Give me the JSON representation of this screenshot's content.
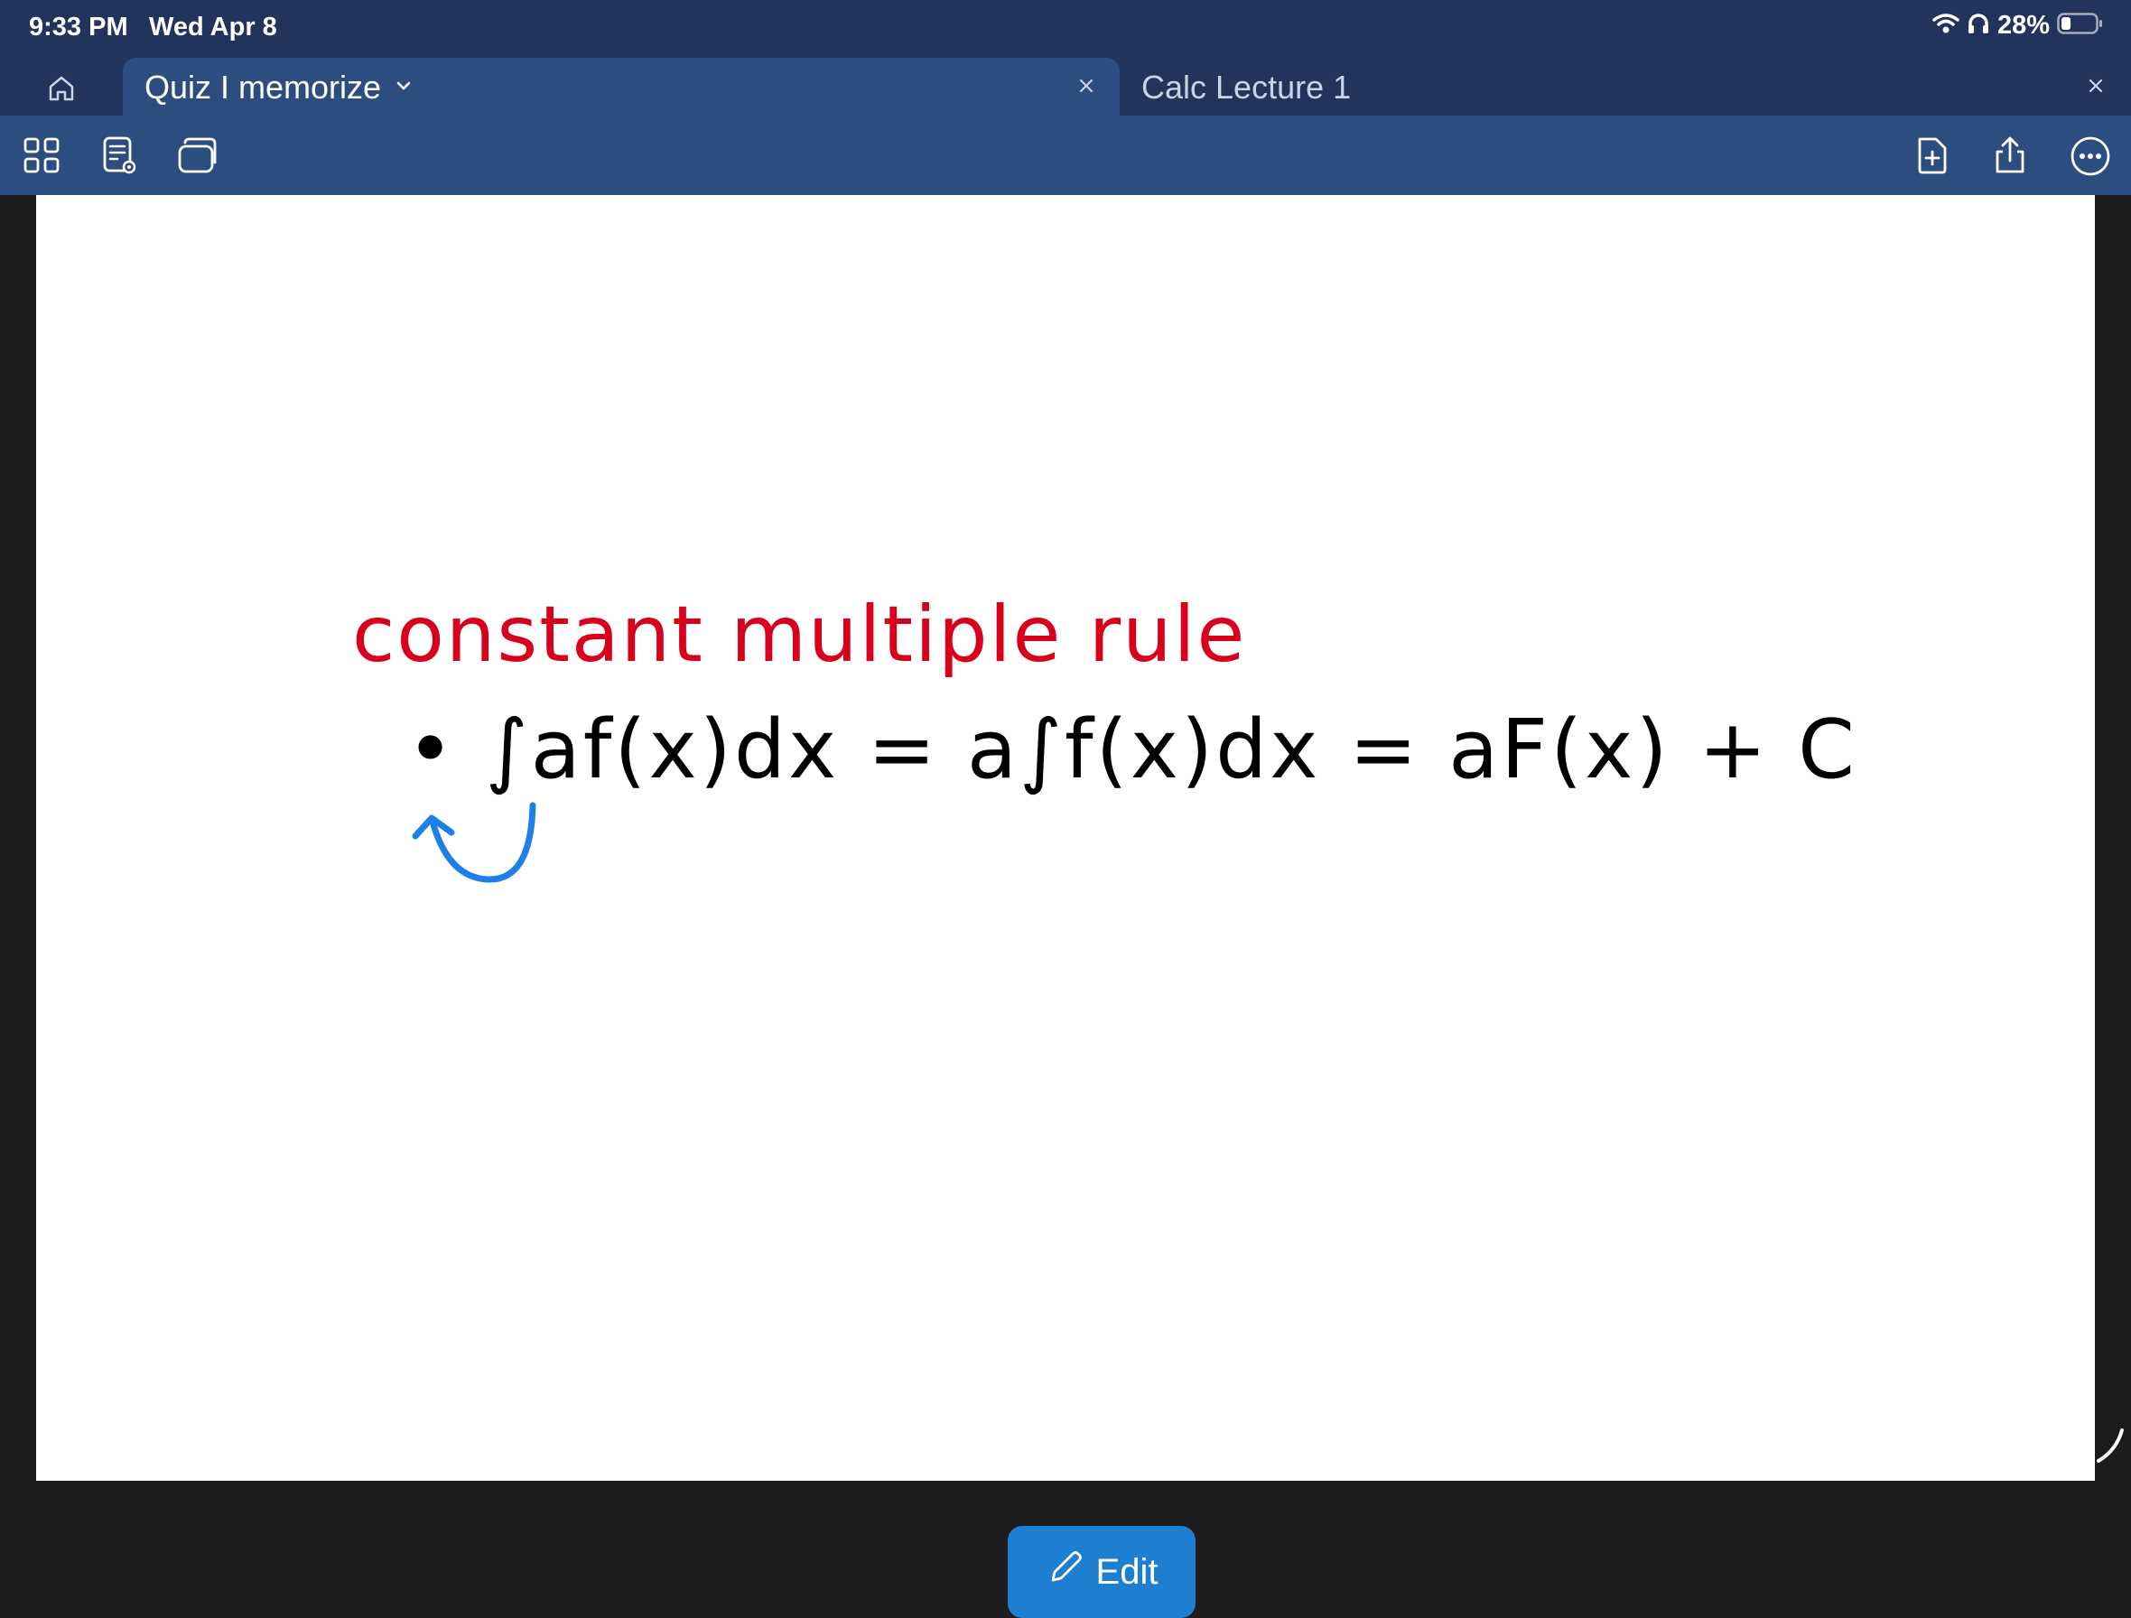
{
  "status_bar": {
    "time": "9:33 PM",
    "date": "Wed Apr 8",
    "battery_percent": "28%",
    "battery_level": 0.28
  },
  "tabs": [
    {
      "title": "Quiz I memorize",
      "active": true
    },
    {
      "title": "Calc Lecture 1",
      "active": false
    }
  ],
  "toolbar": {
    "left_icons": [
      "grid-view-icon",
      "reader-view-icon",
      "windows-icon"
    ],
    "right_icons": [
      "add-page-icon",
      "share-icon",
      "more-icon"
    ]
  },
  "note": {
    "heading": "constant multiple rule",
    "formula": "• ∫af(x)dx = a∫f(x)dx = aF(x) + C",
    "heading_color": "#d8001b",
    "ink_color": "#000000",
    "arrow_color": "#1e7fe6"
  },
  "edit_button": {
    "label": "Edit",
    "color": "#1e7fd1"
  }
}
